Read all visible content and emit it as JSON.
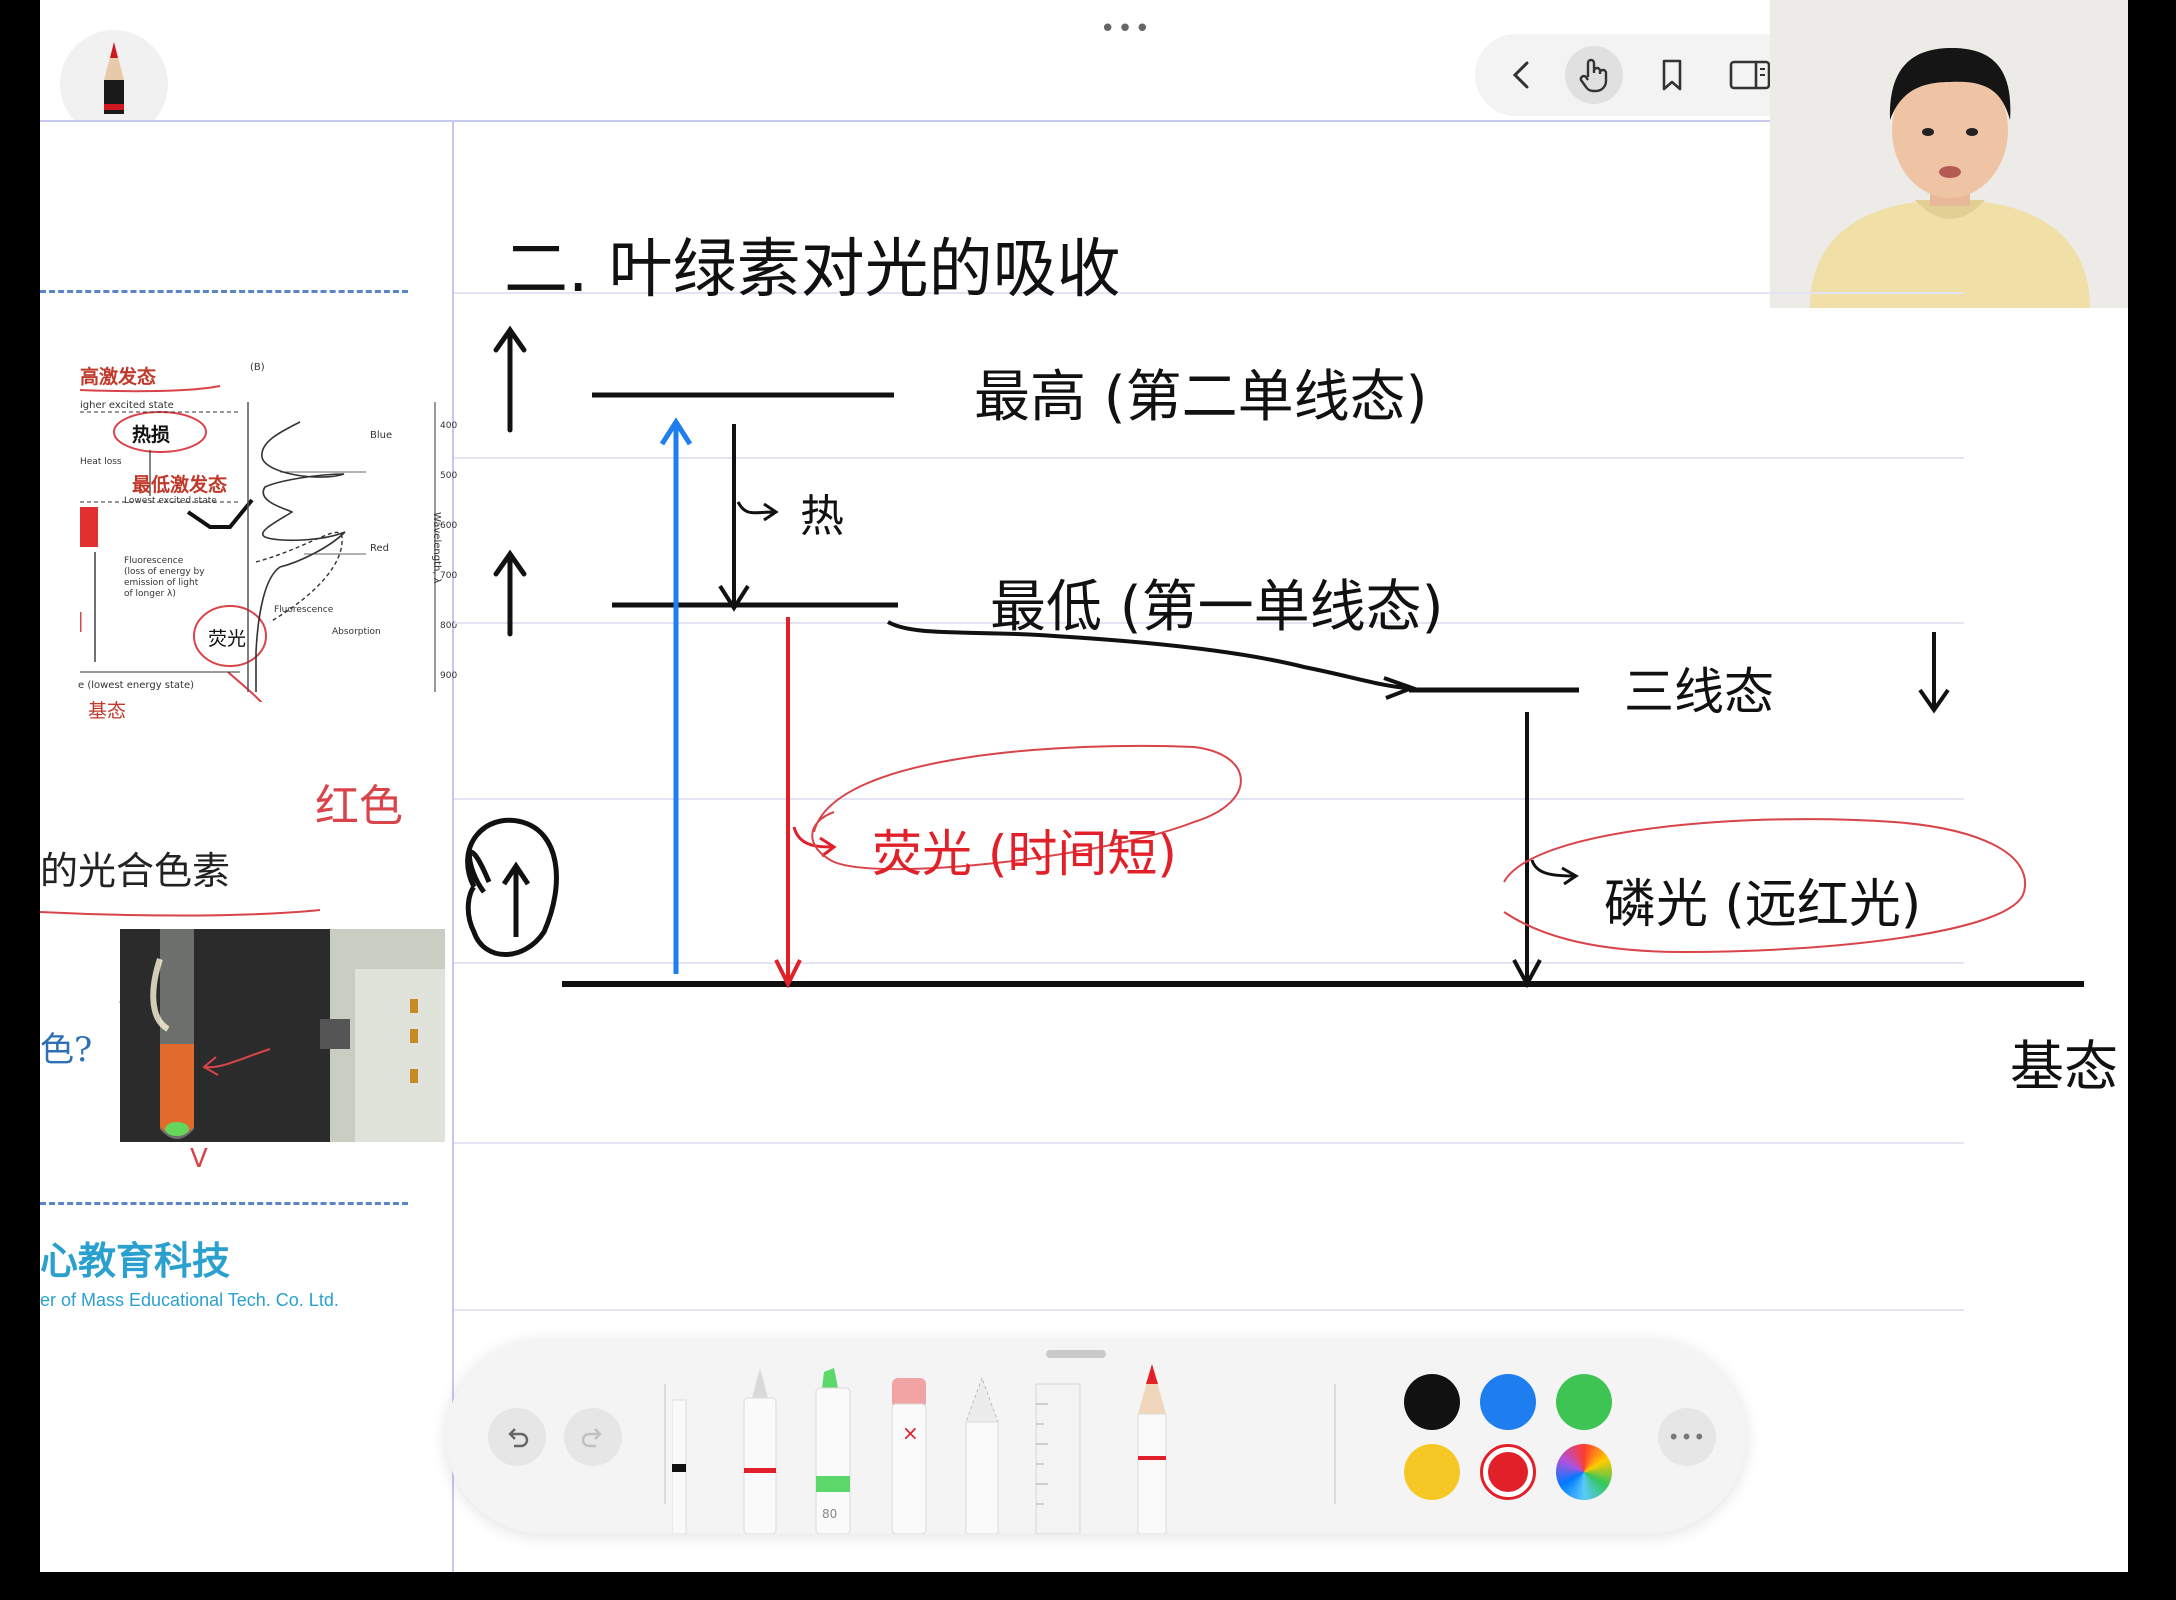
{
  "toolbar": {
    "icons": [
      "pencil-tool-icon",
      "back-icon",
      "hand-icon",
      "bookmark-icon",
      "sidebar-panel-icon",
      "undo-icon",
      "redo-icon",
      "add-icon",
      "more-icon"
    ],
    "more_dots": "•••"
  },
  "sidebar": {
    "spectrum": {
      "panel_label": "(B)",
      "higher_state_cn": "高激发态",
      "higher_state_en": "igher excited state",
      "heat_loss_cn": "热损",
      "heat_loss_en": "Heat loss",
      "lowest_cn": "最低激发态",
      "lowest_en": "Lowest excited state",
      "fluor_en_1": "Fluorescence",
      "fluor_en_2": "(loss of energy by",
      "fluor_en_3": "emission of light",
      "fluor_en_4": "of longer λ)",
      "fluor_cn": "荧光",
      "ground_en": "e (lowest energy state)",
      "ground_cn": "基态",
      "blue": "Blue",
      "red": "Red",
      "fluorescence": "Fluorescence",
      "absorption": "Absorption",
      "wavelength_label": "Wavelength, λ",
      "ticks": [
        "400",
        "500",
        "600",
        "700",
        "800",
        "900"
      ]
    },
    "red_note": "红色",
    "pigments_text": "的光合色素",
    "color_question": "色?",
    "v_mark": "V",
    "company_cn": "心教育科技",
    "company_en": "er of Mass Educational Tech. Co. Ltd."
  },
  "notes": {
    "title": "二. 叶绿素对光的吸收",
    "highest": "最高 (第二单线态)",
    "heat": "热",
    "lowest": "最低 (第一单线态)",
    "triplet": "三线态",
    "fluorescence": "荧光 (时间短)",
    "phosphorescence": "磷光 (远红光)",
    "ground": "基态"
  },
  "pen_toolbar": {
    "icons": [
      "undo-icon",
      "redo-icon",
      "more-icon"
    ],
    "more_dots": "•••",
    "marker_size": "80",
    "tools": [
      "pen",
      "fineliner",
      "marker",
      "eraser",
      "lasso",
      "ruler",
      "pencil"
    ],
    "colors": [
      "#111111",
      "#1e7ef0",
      "#3ec452",
      "#f5c826",
      "#e2202a"
    ]
  }
}
